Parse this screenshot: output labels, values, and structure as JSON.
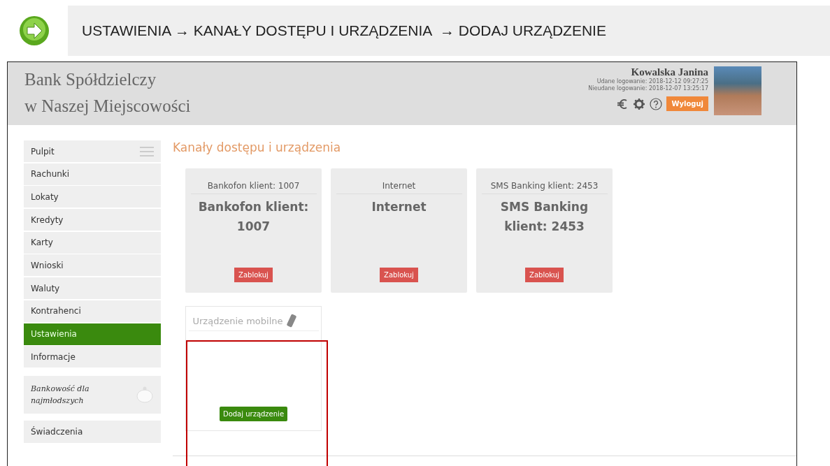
{
  "breadcrumb": "USTAWIENIA → KANAŁY DOSTĘPU I URZĄDZENIA  → DODAJ URZĄDZENIE",
  "bank": {
    "name_line_1": "Bank Spółdzielczy",
    "name_line_2": "w Naszej Miejscowości"
  },
  "user": {
    "name": "Kowalska Janina",
    "last_login": "Udane logowanie: 2018-12-12 09:27:25",
    "failed_login": "Nieudane logowanie: 2018-12-07 13:25:17",
    "logout_button": "Wyloguj"
  },
  "sidebar": {
    "items": [
      {
        "label": "Pulpit",
        "selected": false
      },
      {
        "label": "Rachunki",
        "selected": false
      },
      {
        "label": "Lokaty",
        "selected": false
      },
      {
        "label": "Kredyty",
        "selected": false
      },
      {
        "label": "Karty",
        "selected": false
      },
      {
        "label": "Wnioski",
        "selected": false
      },
      {
        "label": "Waluty",
        "selected": false
      },
      {
        "label": "Kontrahenci",
        "selected": false
      },
      {
        "label": "Ustawienia",
        "selected": true
      },
      {
        "label": "Informacje",
        "selected": false
      }
    ],
    "kids_banner": "Bankowość dla najmłodszych",
    "extra_item": "Świadczenia"
  },
  "page_title": "Kanały dostępu i urządzenia",
  "channels": [
    {
      "header": "Bankofon klient: 1007",
      "title": "Bankofon klient: 1007",
      "button": "Zablokuj"
    },
    {
      "header": "Internet",
      "title": "Internet",
      "button": "Zablokuj"
    },
    {
      "header": "SMS Banking klient: 2453",
      "title": "SMS Banking klient: 2453",
      "button": "Zablokuj"
    }
  ],
  "device_card": {
    "header": "Urządzenie mobilne",
    "button": "Dodaj urządzenie"
  }
}
